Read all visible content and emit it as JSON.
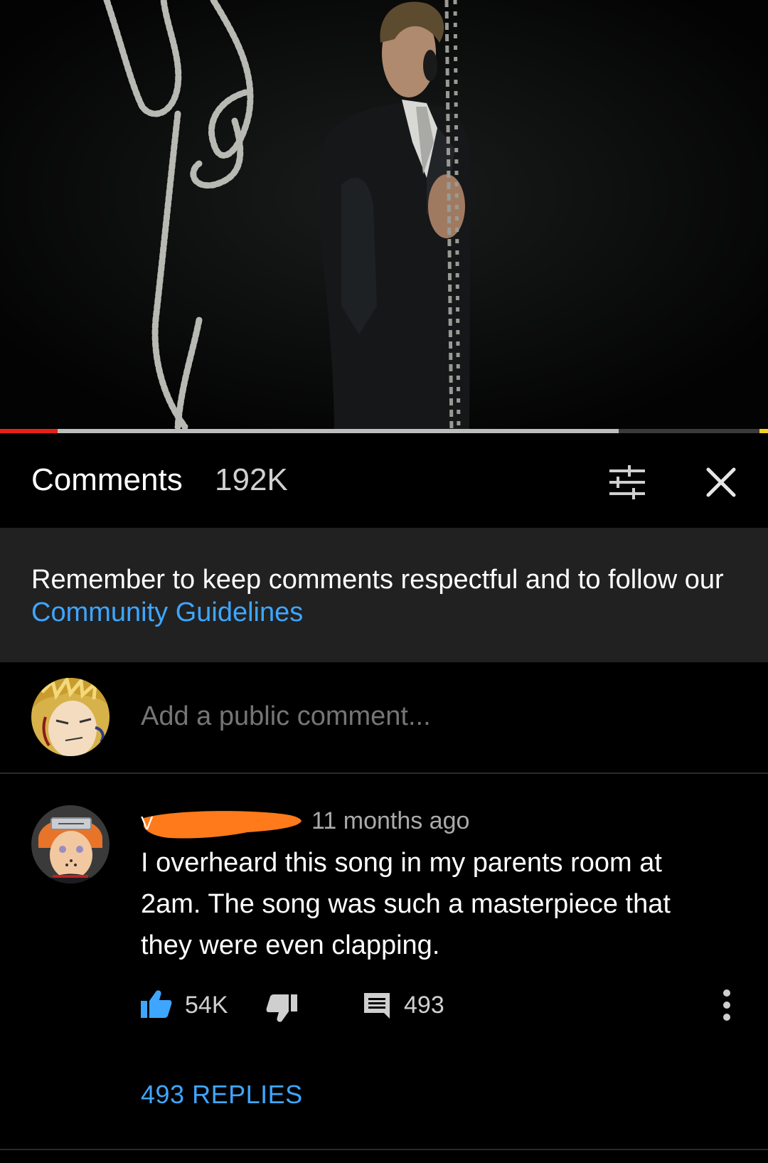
{
  "video": {
    "progress_played": 0.075,
    "progress_buffered": 0.806
  },
  "comments": {
    "title": "Comments",
    "count": "192K"
  },
  "guidelines": {
    "text": "Remember to keep comments respectful and to follow our ",
    "link": "Community Guidelines"
  },
  "add_comment": {
    "placeholder": "Add a public comment..."
  },
  "comment": {
    "time": "11 months ago",
    "body": "I overheard this song in my parents room at 2am. The song was such a masterpiece that they were even clapping.",
    "likes": "54K",
    "replies_count": "493",
    "replies_link": "493 REPLIES"
  },
  "colors": {
    "link": "#3ea6ff",
    "progress_played": "#e62117",
    "banner_bg": "#212121",
    "redaction": "#ff7a1a"
  }
}
